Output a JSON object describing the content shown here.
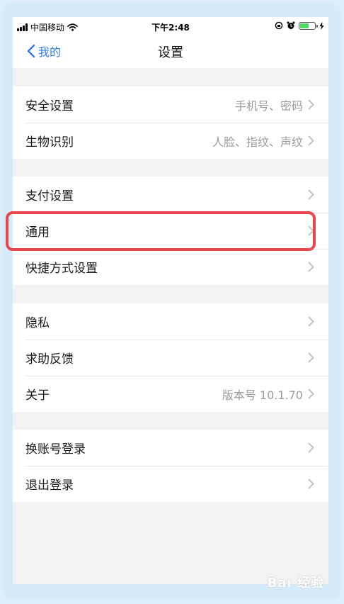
{
  "status_bar": {
    "carrier": "中国移动",
    "time": "下午2:48"
  },
  "nav": {
    "back_label": "我的",
    "title": "设置"
  },
  "groups": [
    [
      {
        "label": "安全设置",
        "value": "手机号、密码"
      },
      {
        "label": "生物识别",
        "value": "人脸、指纹、声纹"
      }
    ],
    [
      {
        "label": "支付设置",
        "value": ""
      },
      {
        "label": "通用",
        "value": ""
      },
      {
        "label": "快捷方式设置",
        "value": ""
      }
    ],
    [
      {
        "label": "隐私",
        "value": ""
      },
      {
        "label": "求助反馈",
        "value": ""
      },
      {
        "label": "关于",
        "value": "版本号 10.1.70"
      }
    ],
    [
      {
        "label": "换账号登录",
        "value": ""
      },
      {
        "label": "退出登录",
        "value": ""
      }
    ]
  ],
  "watermark": "Bai 经验",
  "colors": {
    "accent": "#2e7cf6",
    "highlight": "#e8484c",
    "background": "#f2f2f5"
  }
}
